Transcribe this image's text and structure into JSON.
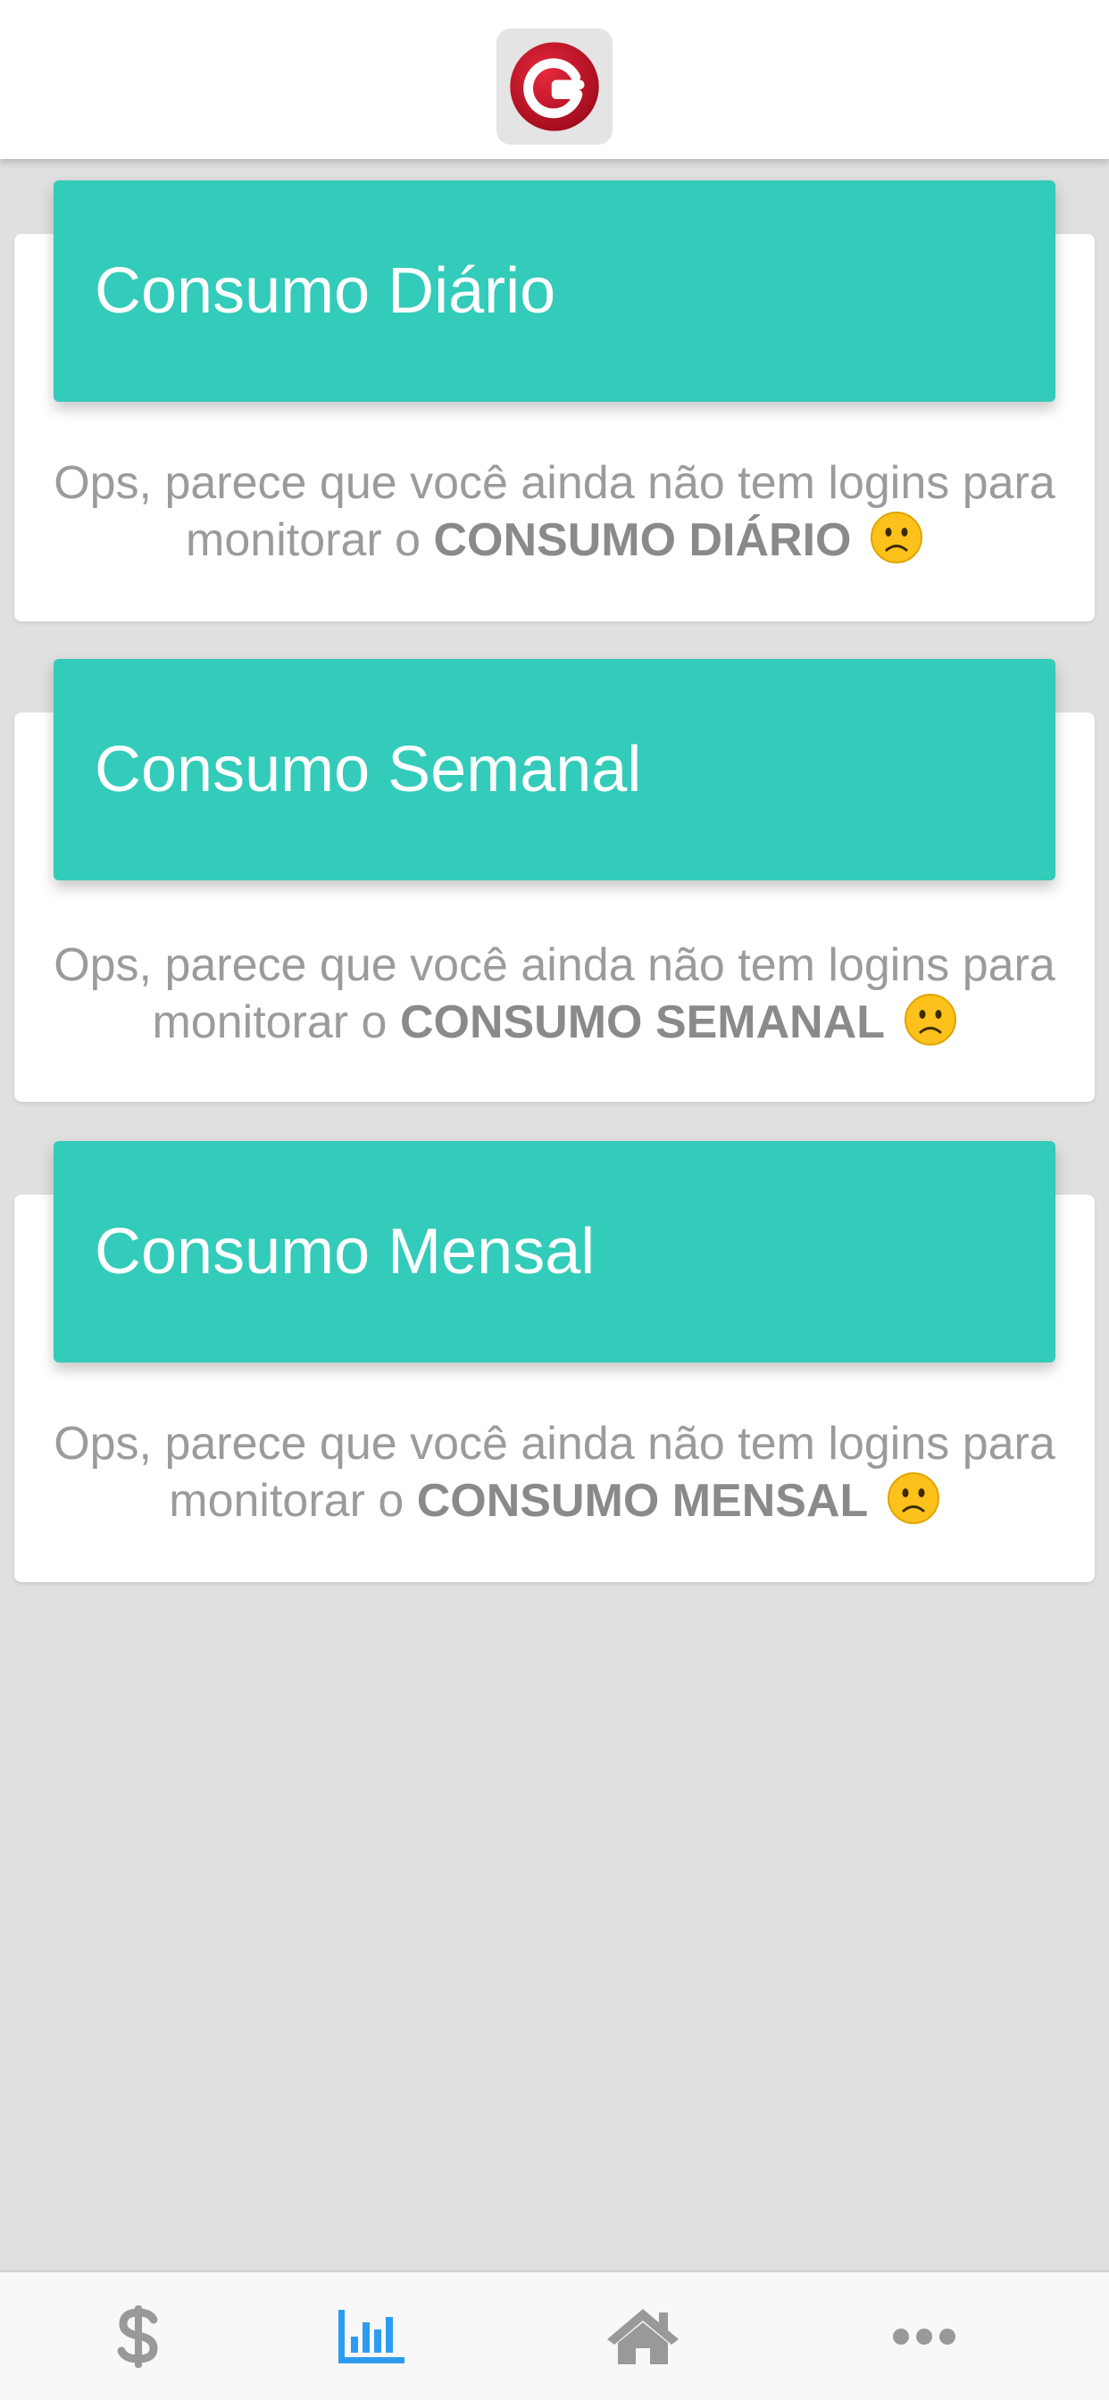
{
  "header": {
    "logo_letter": "G",
    "logo_colors": {
      "outer": "#c8102e",
      "inner": "#ffffff",
      "background": "#e4e4e4"
    }
  },
  "cards": [
    {
      "title": "Consumo Diário",
      "message": "Ops, parece que você ainda não tem logins para monitorar o",
      "emphasis": "CONSUMO DIÁRIO",
      "emoji": "slightly-frowning-face-icon"
    },
    {
      "title": "Consumo Semanal",
      "message": "Ops, parece que você ainda não tem logins para monitorar o",
      "emphasis": "CONSUMO SEMANAL",
      "emoji": "slightly-frowning-face-icon"
    },
    {
      "title": "Consumo Mensal",
      "message": "Ops, parece que você ainda não tem logins para monitorar o",
      "emphasis": "CONSUMO MENSAL",
      "emoji": "slightly-frowning-face-icon"
    }
  ],
  "bottom_nav": {
    "items": [
      {
        "icon": "dollar-icon",
        "active": false
      },
      {
        "icon": "bar-chart-icon",
        "active": true
      },
      {
        "icon": "home-icon",
        "active": false
      },
      {
        "icon": "more-icon",
        "active": false
      }
    ],
    "active_color": "#2d9cf0",
    "inactive_color": "#999999"
  },
  "colors": {
    "card_header": "#33cbb9",
    "background": "#e0e0e0",
    "message_text": "#9b9b9b"
  }
}
